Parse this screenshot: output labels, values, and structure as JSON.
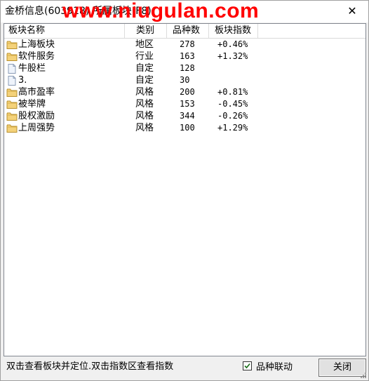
{
  "window": {
    "title": "金桥信息(603918) 所属板块(F8)",
    "watermark": "www.niugulan.com",
    "close_glyph": "✕"
  },
  "list": {
    "headers": {
      "name": "板块名称",
      "type": "类别",
      "count": "品种数",
      "index": "板块指数"
    },
    "rows": [
      {
        "icon": "folder-icon",
        "name": "上海板块",
        "type": "地区",
        "count": "278",
        "index": "+0.46%"
      },
      {
        "icon": "folder-icon",
        "name": "软件服务",
        "type": "行业",
        "count": "163",
        "index": "+1.32%"
      },
      {
        "icon": "document-icon",
        "name": "牛股栏",
        "type": "自定",
        "count": "128",
        "index": ""
      },
      {
        "icon": "document-icon",
        "name": "3.",
        "type": "自定",
        "count": "30",
        "index": ""
      },
      {
        "icon": "folder-icon",
        "name": "高市盈率",
        "type": "风格",
        "count": "200",
        "index": "+0.81%"
      },
      {
        "icon": "folder-icon",
        "name": "被举牌",
        "type": "风格",
        "count": "153",
        "index": "-0.45%"
      },
      {
        "icon": "folder-icon",
        "name": "股权激励",
        "type": "风格",
        "count": "344",
        "index": "-0.26%"
      },
      {
        "icon": "folder-icon",
        "name": "上周强势",
        "type": "风格",
        "count": "100",
        "index": "+1.29%"
      }
    ]
  },
  "footer": {
    "hint": "双击查看板块并定位.双击指数区查看指数",
    "checkbox_label": "品种联动",
    "checkbox_checked": true,
    "close_button": "关闭"
  }
}
